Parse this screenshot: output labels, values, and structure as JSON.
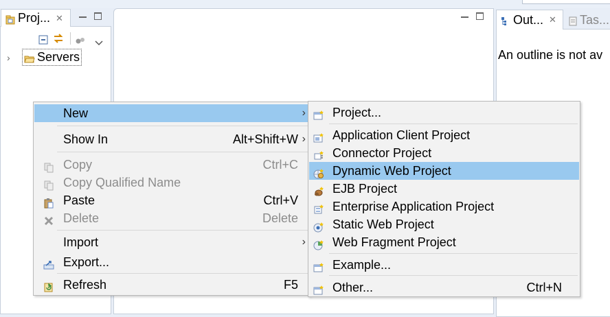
{
  "project_explorer": {
    "tab_label": "Proj...",
    "tree": [
      {
        "label": "Servers"
      }
    ]
  },
  "outline": {
    "tab_label": "Out...",
    "tasks_tab_label": "Tas...",
    "message": "An outline is not av"
  },
  "context_menu": {
    "items": [
      {
        "label": "New",
        "shortcut": "",
        "icon": "",
        "submenu": true,
        "highlighted": true,
        "disabled": false
      },
      {
        "label": "Show In",
        "shortcut": "Alt+Shift+W",
        "icon": "",
        "submenu": true,
        "highlighted": false,
        "disabled": false
      },
      {
        "label": "Copy",
        "shortcut": "Ctrl+C",
        "icon": "copy-icon",
        "submenu": false,
        "highlighted": false,
        "disabled": true
      },
      {
        "label": "Copy Qualified Name",
        "shortcut": "",
        "icon": "copy-qualified-name-icon",
        "submenu": false,
        "highlighted": false,
        "disabled": true
      },
      {
        "label": "Paste",
        "shortcut": "Ctrl+V",
        "icon": "paste-icon",
        "submenu": false,
        "highlighted": false,
        "disabled": false
      },
      {
        "label": "Delete",
        "shortcut": "Delete",
        "icon": "delete-icon",
        "submenu": false,
        "highlighted": false,
        "disabled": true
      },
      {
        "label": "Import",
        "shortcut": "",
        "icon": "",
        "submenu": true,
        "highlighted": false,
        "disabled": false
      },
      {
        "label": "Export...",
        "shortcut": "",
        "icon": "export-icon",
        "submenu": false,
        "highlighted": false,
        "disabled": false
      },
      {
        "label": "Refresh",
        "shortcut": "F5",
        "icon": "refresh-icon",
        "submenu": false,
        "highlighted": false,
        "disabled": false
      }
    ]
  },
  "new_submenu": {
    "items": [
      {
        "label": "Project...",
        "shortcut": "",
        "icon": "new-project-icon",
        "highlighted": false
      },
      {
        "label": "Application Client Project",
        "shortcut": "",
        "icon": "application-client-project-icon",
        "highlighted": false
      },
      {
        "label": "Connector Project",
        "shortcut": "",
        "icon": "connector-project-icon",
        "highlighted": false
      },
      {
        "label": "Dynamic Web Project",
        "shortcut": "",
        "icon": "dynamic-web-project-icon",
        "highlighted": true
      },
      {
        "label": "EJB Project",
        "shortcut": "",
        "icon": "ejb-project-icon",
        "highlighted": false
      },
      {
        "label": "Enterprise Application Project",
        "shortcut": "",
        "icon": "enterprise-application-project-icon",
        "highlighted": false
      },
      {
        "label": "Static Web Project",
        "shortcut": "",
        "icon": "static-web-project-icon",
        "highlighted": false
      },
      {
        "label": "Web Fragment Project",
        "shortcut": "",
        "icon": "web-fragment-project-icon",
        "highlighted": false
      },
      {
        "label": "Example...",
        "shortcut": "",
        "icon": "example-icon",
        "highlighted": false
      },
      {
        "label": "Other...",
        "shortcut": "Ctrl+N",
        "icon": "other-wizard-icon",
        "highlighted": false
      }
    ]
  },
  "colors": {
    "highlight": "#99c9ef",
    "menu_background": "#f2f2f2",
    "disabled_text": "#8c8c8c"
  }
}
